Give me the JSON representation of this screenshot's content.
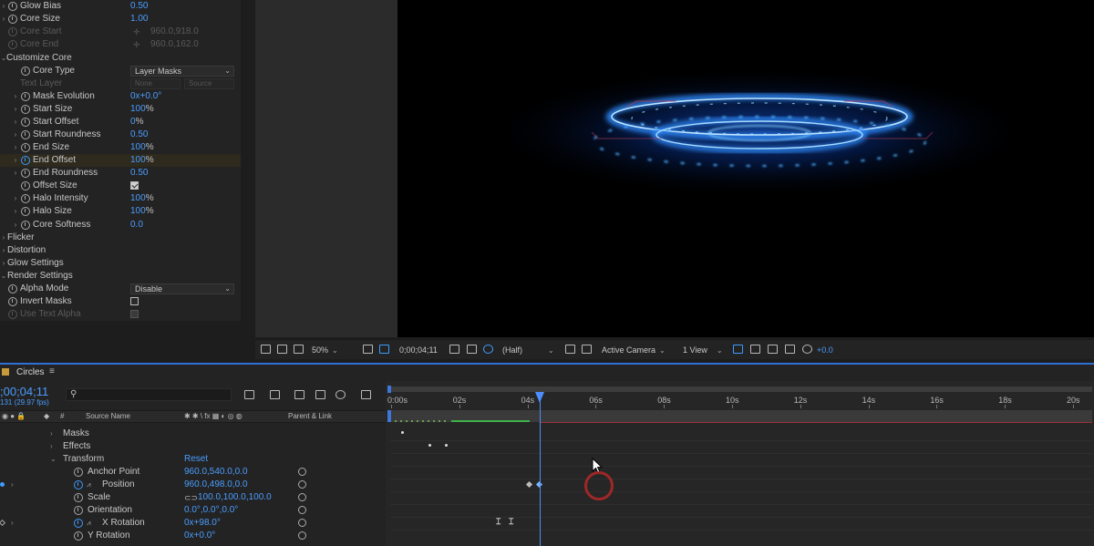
{
  "effect_controls": {
    "glow_bias": {
      "label": "Glow Bias",
      "value": "0.50"
    },
    "core_size": {
      "label": "Core Size",
      "value": "1.00"
    },
    "core_start": {
      "label": "Core Start",
      "value": "960.0,918.0"
    },
    "core_end": {
      "label": "Core End",
      "value": "960.0,162.0"
    },
    "customize_core": {
      "label": "Customize Core"
    },
    "core_type": {
      "label": "Core Type",
      "value": "Layer Masks"
    },
    "text_layer": {
      "label": "Text Layer",
      "layer": "None",
      "source": "Source"
    },
    "mask_evolution": {
      "label": "Mask Evolution",
      "value": "0x+0.0°"
    },
    "start_size": {
      "label": "Start Size",
      "value": "100",
      "unit": "%"
    },
    "start_offset": {
      "label": "Start Offset",
      "value": "0",
      "unit": "%"
    },
    "start_roundness": {
      "label": "Start Roundness",
      "value": "0.50"
    },
    "end_size": {
      "label": "End Size",
      "value": "100",
      "unit": "%"
    },
    "end_offset": {
      "label": "End Offset",
      "value": "100",
      "unit": "%"
    },
    "end_roundness": {
      "label": "End Roundness",
      "value": "0.50"
    },
    "offset_size": {
      "label": "Offset Size",
      "checked": true
    },
    "halo_intensity": {
      "label": "Halo Intensity",
      "value": "100",
      "unit": "%"
    },
    "halo_size": {
      "label": "Halo Size",
      "value": "100",
      "unit": "%"
    },
    "core_softness": {
      "label": "Core Softness",
      "value": "0.0"
    },
    "flicker": {
      "label": "Flicker"
    },
    "distortion": {
      "label": "Distortion"
    },
    "glow_settings": {
      "label": "Glow Settings"
    },
    "render_settings": {
      "label": "Render Settings"
    },
    "alpha_mode": {
      "label": "Alpha Mode",
      "value": "Disable"
    },
    "invert_masks": {
      "label": "Invert Masks",
      "checked": false
    },
    "use_text_alpha": {
      "label": "Use Text Alpha",
      "checked": true
    }
  },
  "viewer_toolbar": {
    "zoom": "50%",
    "timecode": "0;00;04;11",
    "resolution": "(Half)",
    "camera": "Active Camera",
    "views": "1 View",
    "exposure": "+0.0"
  },
  "timeline": {
    "comp_name": "Circles",
    "current_time": ";00;04;11",
    "frame_info": "131 (29.97 fps)",
    "search_placeholder": "",
    "col_num": "#",
    "col_source_name": "Source Name",
    "col_parent": "Parent & Link",
    "ruler_ticks": [
      "0:00s",
      "02s",
      "04s",
      "06s",
      "08s",
      "10s",
      "12s",
      "14s",
      "16s",
      "18s",
      "20s"
    ],
    "current_time_seconds": 4.37,
    "ruler_max_seconds": 20,
    "masks": "Masks",
    "effects": "Effects",
    "transform": "Transform",
    "reset": "Reset",
    "anchor_point": {
      "label": "Anchor Point",
      "value": "960.0,540.0,0.0"
    },
    "position": {
      "label": "Position",
      "value": "960.0,498.0,0.0"
    },
    "scale": {
      "label": "Scale",
      "value": "100.0,100.0,100.0"
    },
    "orientation": {
      "label": "Orientation",
      "value": "0.0°,0.0°,0.0°"
    },
    "x_rotation": {
      "label": "X Rotation",
      "value": "0x+98.0°"
    },
    "y_rotation": {
      "label": "Y Rotation",
      "value": "0x+0.0°"
    }
  },
  "colors": {
    "accent": "#2f8cff",
    "value_blue": "#4a9dff",
    "glow_cyan": "#3fb6ff",
    "playhead": "#4d8dff"
  }
}
